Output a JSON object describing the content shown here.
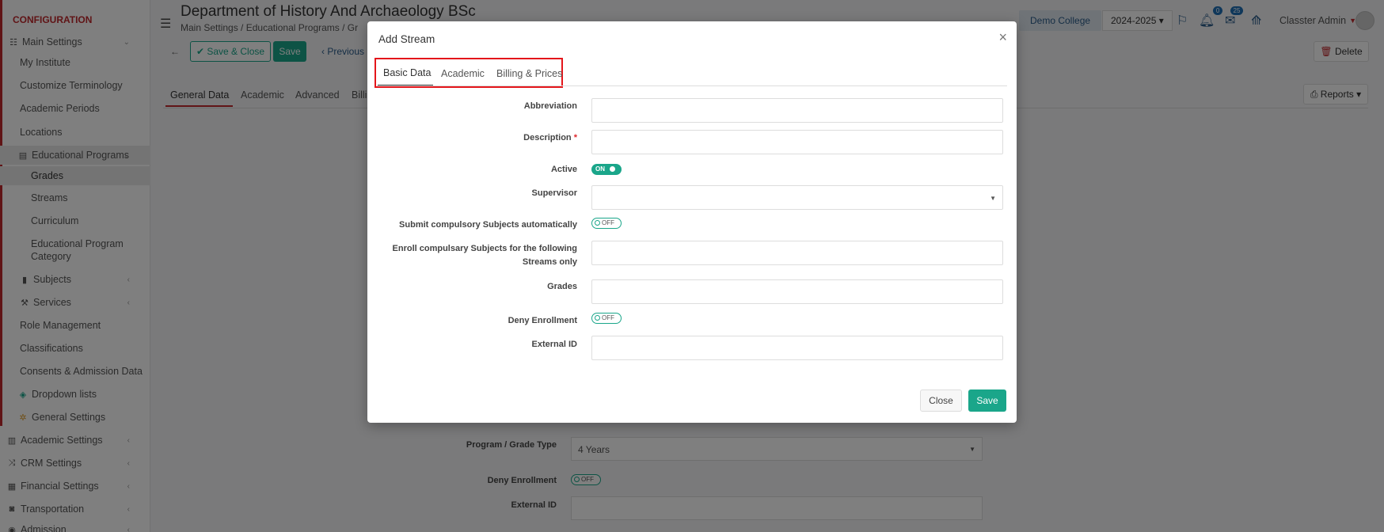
{
  "sidebar": {
    "header": "CONFIGURATION",
    "items": [
      {
        "label": "Main Settings",
        "icon": "sliders-icon"
      },
      {
        "label": "My Institute"
      },
      {
        "label": "Customize Terminology"
      },
      {
        "label": "Academic Periods"
      },
      {
        "label": "Locations"
      },
      {
        "label": "Educational Programs",
        "icon": "grid-icon"
      },
      {
        "label": "Grades"
      },
      {
        "label": "Streams"
      },
      {
        "label": "Curriculum"
      },
      {
        "label": "Educational Program"
      },
      {
        "label": "Category"
      },
      {
        "label": "Subjects",
        "icon": "book-icon"
      },
      {
        "label": "Services",
        "icon": "services-icon"
      },
      {
        "label": "Role Management"
      },
      {
        "label": "Classifications"
      },
      {
        "label": "Consents & Admission Data"
      },
      {
        "label": "Dropdown lists",
        "icon": "layers-icon"
      },
      {
        "label": "General Settings",
        "icon": "gear-icon"
      },
      {
        "label": "Academic Settings",
        "icon": "building-icon"
      },
      {
        "label": "CRM Settings",
        "icon": "crm-icon"
      },
      {
        "label": "Financial Settings",
        "icon": "money-icon"
      },
      {
        "label": "Transportation",
        "icon": "bus-icon"
      },
      {
        "label": "Admission",
        "icon": "admission-icon"
      }
    ]
  },
  "header": {
    "title": "Department of History And Archaeology BSc",
    "breadcrumb": [
      "Main Settings",
      "Educational Programs",
      "Gr"
    ],
    "college": "Demo College",
    "year": "2024-2025",
    "notifications_count": "0",
    "messages_count": "25",
    "user": "Classter Admin",
    "delete_label": "Delete",
    "reports_label": "Reports"
  },
  "toolbar": {
    "save_close_label": "Save & Close",
    "save_label": "Save",
    "previous_label": "Previous"
  },
  "page_tabs": [
    "General Data",
    "Academic",
    "Advanced",
    "Billi"
  ],
  "background_form": {
    "program_type_label": "Program / Grade Type",
    "program_type_value": "4 Years",
    "deny_enrollment_label": "Deny Enrollment",
    "deny_enrollment_value": "OFF",
    "external_id_label": "External ID"
  },
  "modal": {
    "title": "Add Stream",
    "close_icon": "×",
    "tabs": [
      "Basic Data",
      "Academic",
      "Billing & Prices"
    ],
    "fields": {
      "abbreviation": "Abbreviation",
      "description": "Description",
      "required_marker": "*",
      "active": "Active",
      "active_value": "ON",
      "supervisor": "Supervisor",
      "submit_compulsory": "Submit compulsory Subjects automatically",
      "submit_compulsory_value": "OFF",
      "enroll_compulsory_line1": "Enroll compulsary Subjects for the following",
      "enroll_compulsory_line2": "Streams only",
      "grades": "Grades",
      "deny_enrollment": "Deny Enrollment",
      "deny_enrollment_value": "OFF",
      "external_id": "External ID"
    },
    "close_button": "Close",
    "save_button": "Save"
  },
  "colors": {
    "brand_red": "#c0282d",
    "accent_green": "#1aa68a",
    "highlight_red": "#e4161b"
  }
}
